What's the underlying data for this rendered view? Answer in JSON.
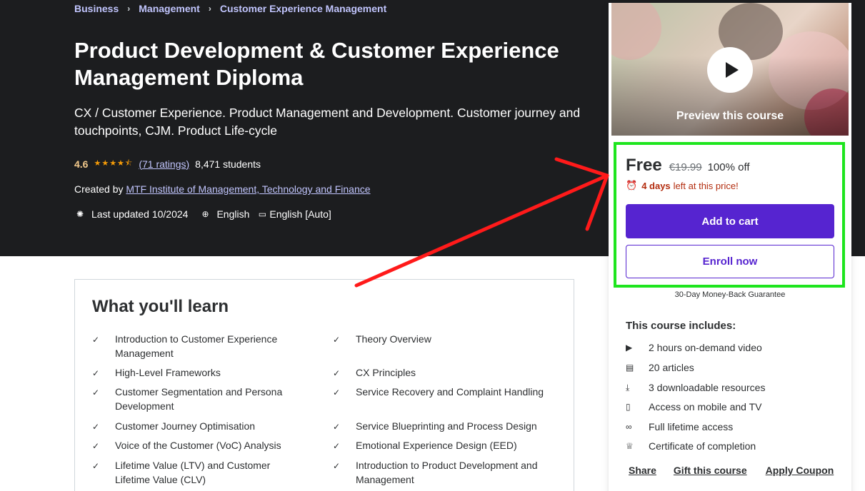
{
  "breadcrumb": [
    "Business",
    "Management",
    "Customer Experience Management"
  ],
  "course": {
    "title": "Product Development & Customer Experience Management Diploma",
    "subtitle": "CX / Customer Experience. Product Management and Development. Customer journey and touchpoints, CJM. Product Life-cycle",
    "rating": "4.6",
    "stars": 4.5,
    "ratings_count": "(71 ratings)",
    "students": "8,471 students",
    "created_by_label": "Created by",
    "author": "MTF Institute of Management, Technology and Finance",
    "last_updated": "Last updated 10/2024",
    "language": "English",
    "captions": "English [Auto]"
  },
  "learn": {
    "title": "What you'll learn",
    "items": [
      "Introduction to Customer Experience Management",
      "Theory Overview",
      "High-Level Frameworks",
      "CX Principles",
      "Customer Segmentation and Persona Development",
      "Service Recovery and Complaint Handling",
      "Customer Journey Optimisation",
      "Service Blueprinting and Process Design",
      "Voice of the Customer (VoC) Analysis",
      "Emotional Experience Design (EED)",
      "Lifetime Value (LTV) and Customer Lifetime Value (CLV)",
      "Introduction to Product Development and Management"
    ]
  },
  "sidebar": {
    "preview_label": "Preview this course",
    "price": "Free",
    "original_price": "€19.99",
    "discount": "100% off",
    "timer_bold": "4 days",
    "timer_rest": "left at this price!",
    "add_to_cart": "Add to cart",
    "enroll_now": "Enroll now",
    "guarantee": "30-Day Money-Back Guarantee",
    "includes_title": "This course includes:",
    "includes": [
      {
        "icon": "video-icon",
        "text": "2 hours on-demand video"
      },
      {
        "icon": "article-icon",
        "text": "20 articles"
      },
      {
        "icon": "download-icon",
        "text": "3 downloadable resources"
      },
      {
        "icon": "mobile-icon",
        "text": "Access on mobile and TV"
      },
      {
        "icon": "infinity-icon",
        "text": "Full lifetime access"
      },
      {
        "icon": "trophy-icon",
        "text": "Certificate of completion"
      }
    ],
    "links": [
      "Share",
      "Gift this course",
      "Apply Coupon"
    ]
  },
  "colors": {
    "hero_bg": "#1c1d1f",
    "accent_purple": "#5624d0",
    "link_lavender": "#c0c4fc",
    "rating_gold": "#f3ca8c",
    "highlight_green": "#1ee51e",
    "annotation_arrow": "#ff1a1a",
    "timer_red": "#b32d0f"
  }
}
